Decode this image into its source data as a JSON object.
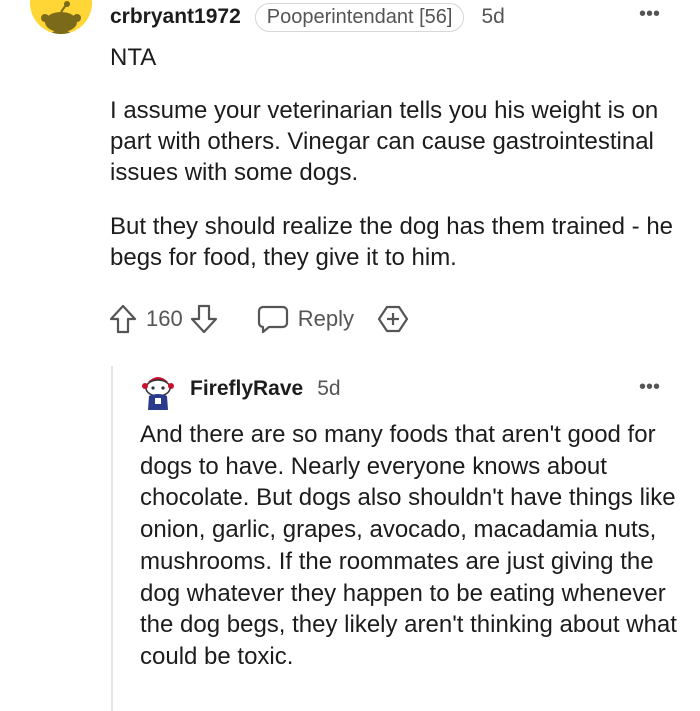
{
  "comment": {
    "avatar_icon": "reddit-snoo-avatar-icon",
    "avatar_color": "#ffd635",
    "username": "crbryant1972",
    "flair": "Pooperintendant [56]",
    "time": "5d",
    "more_icon": "more-options-icon",
    "more_label": "•••",
    "verdict": "NTA",
    "paragraphs": [
      "I assume your veterinarian tells you his weight is on part with others. Vinegar can cause gastrointestinal issues with some dogs.",
      "But they should realize the dog has them trained - he begs for food, they give it to him."
    ],
    "actions": {
      "upvote_icon": "upvote-arrow-icon",
      "vote_count": "160",
      "downvote_icon": "downvote-arrow-icon",
      "reply_icon": "chat-bubble-icon",
      "reply_label": "Reply",
      "award_icon": "award-plus-icon"
    }
  },
  "reply": {
    "avatar_icon": "reddit-custom-avatar-icon",
    "username": "FireflyRave",
    "time": "5d",
    "more_icon": "more-options-icon",
    "more_label": "•••",
    "body": "And there are so many foods that aren't good for dogs to have. Nearly everyone knows about chocolate. But dogs also shouldn't have things like onion, garlic, grapes, avocado, macadamia nuts, mushrooms. If the roommates are just giving the dog whatever they happen to be eating whenever the dog begs, they likely aren't thinking about what could be toxic."
  },
  "colors": {
    "text": "#1c1c1c",
    "muted": "#555555",
    "border": "#d6d6d6",
    "thread_line": "#e5e5e5",
    "background": "#ffffff"
  }
}
